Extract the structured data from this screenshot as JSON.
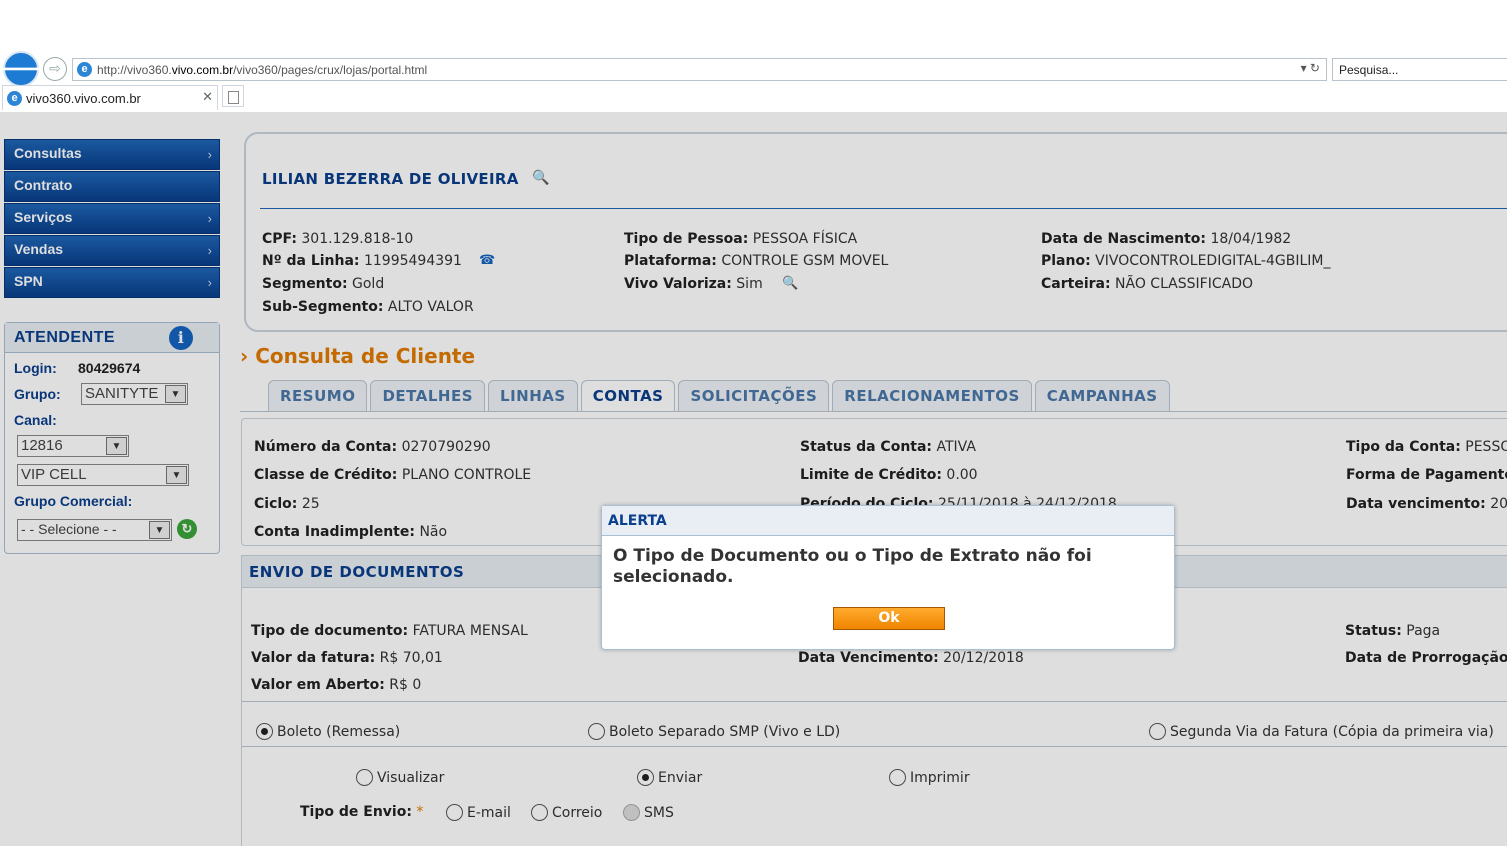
{
  "browser": {
    "url_prefix": "http://vivo360.",
    "url_domain": "vivo.com.br",
    "url_path": "/vivo360/pages/crux/lojas/portal.html",
    "search_placeholder": "Pesquisa...",
    "tab_title": "vivo360.vivo.com.br",
    "ie_glyph": "e",
    "addr_controls": "▾ ↻"
  },
  "menu": {
    "items": [
      {
        "label": "Consultas",
        "arrow": "›"
      },
      {
        "label": "Contrato",
        "arrow": ""
      },
      {
        "label": "Serviços",
        "arrow": "›"
      },
      {
        "label": "Vendas",
        "arrow": "›"
      },
      {
        "label": "SPN",
        "arrow": "›"
      }
    ]
  },
  "atendente": {
    "title": "ATENDENTE",
    "info_glyph": "i",
    "login_label": "Login:",
    "login_value": "80429674",
    "grupo_label": "Grupo:",
    "grupo_value": "SANITYTE",
    "canal_label": "Canal:",
    "canal_value": "12816",
    "canal2_value": "VIP CELL",
    "grupo_comercial_label": "Grupo Comercial:",
    "grupo_comercial_value": "- - Selecione - -",
    "dropdown_glyph": "▼",
    "refresh_glyph": "↻"
  },
  "customer": {
    "name": "LILIAN BEZERRA DE OLIVEIRA",
    "fields": {
      "cpf_label": "CPF:",
      "cpf": "301.129.818-10",
      "linha_label": "Nº da Linha:",
      "linha": "11995494391",
      "segmento_label": "Segmento:",
      "segmento": "Gold",
      "subseg_label": "Sub-Segmento:",
      "subseg": "ALTO VALOR",
      "tipo_pessoa_label": "Tipo de Pessoa:",
      "tipo_pessoa": "PESSOA FÍSICA",
      "plataforma_label": "Plataforma:",
      "plataforma": "CONTROLE GSM MOVEL",
      "valoriza_label": "Vivo Valoriza:",
      "valoriza": "Sim",
      "nasc_label": "Data de Nascimento:",
      "nasc": "18/04/1982",
      "plano_label": "Plano:",
      "plano": "VIVOCONTROLEDIGITAL-4GBILIM_",
      "carteira_label": "Carteira:",
      "carteira": "NÃO CLASSIFICADO"
    },
    "search_glyph": "🔍",
    "phone_glyph": "☎"
  },
  "section_arrow": "›",
  "section_title": "Consulta de Cliente",
  "tabs": [
    "RESUMO",
    "DETALHES",
    "LINHAS",
    "CONTAS",
    "SOLICITAÇÕES",
    "RELACIONAMENTOS",
    "CAMPANHAS"
  ],
  "conta": {
    "numero_label": "Número da Conta:",
    "numero": "0270790290",
    "classe_label": "Classe de Crédito:",
    "classe": "PLANO CONTROLE",
    "ciclo_label": "Ciclo:",
    "ciclo": "25",
    "inad_label": "Conta Inadimplente:",
    "inad": "Não",
    "status_label": "Status da Conta:",
    "status": "ATIVA",
    "limite_label": "Limite de Crédito:",
    "limite": "0.00",
    "periodo_label": "Período do Ciclo:",
    "periodo": "25/11/2018 à 24/12/2018",
    "tipo_label": "Tipo da Conta:",
    "tipo": "PESSO",
    "forma_label": "Forma de Pagamento",
    "venc_label": "Data vencimento:",
    "venc": "20"
  },
  "envio": {
    "title": "ENVIO DE DOCUMENTOS",
    "tipo_doc_label": "Tipo de documento:",
    "tipo_doc": "FATURA MENSAL",
    "valor_label": "Valor da fatura:",
    "valor": "R$ 70,01",
    "aberto_label": "Valor em Aberto:",
    "aberto": "R$ 0",
    "dvenc_label": "Data Vencimento:",
    "dvenc": "20/12/2018",
    "status_label": "Status:",
    "status": "Paga",
    "prorrog_label": "Data de Prorrogação",
    "radio_boleto": "Boleto (Remessa)",
    "radio_separado": "Boleto Separado SMP (Vivo e LD)",
    "radio_segunda": "Segunda Via da Fatura (Cópia da primeira via)",
    "radio_visualizar": "Visualizar",
    "radio_enviar": "Enviar",
    "radio_imprimir": "Imprimir",
    "tipo_envio_label": "Tipo de Envio:",
    "required_mark": "*",
    "radio_email": "E-mail",
    "radio_correio": "Correio",
    "radio_sms": "SMS"
  },
  "modal": {
    "title": "ALERTA",
    "message": "O Tipo de Documento ou o Tipo de Extrato não foi selecionado.",
    "ok_label": "Ok"
  }
}
